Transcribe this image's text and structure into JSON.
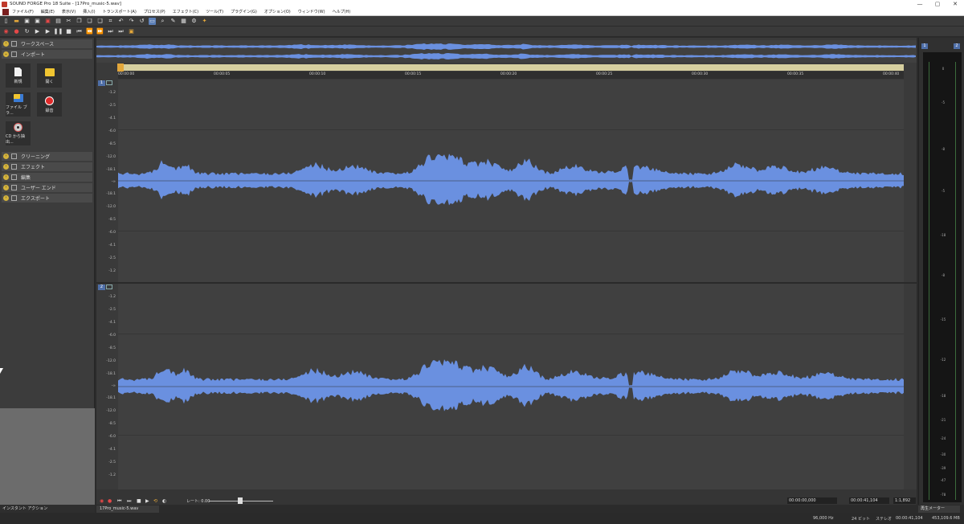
{
  "window": {
    "title": "SOUND FORGE Pro 18 Suite - [17Pro_music-5.wav]",
    "controls": [
      "—",
      "▢",
      "✕"
    ]
  },
  "menu": [
    "ファイル(F)",
    "編集(E)",
    "表示(V)",
    "挿入(I)",
    "トランスポート(A)",
    "プロセス(P)",
    "エフェクト(C)",
    "ツール(T)",
    "プラグイン(G)",
    "オプション(O)",
    "ウィンドウ(W)",
    "ヘルプ(H)"
  ],
  "left_panel": {
    "workspace": "ワークスペース",
    "import": "インポート",
    "tiles": [
      {
        "label": "新規",
        "icon": "new-file-icon"
      },
      {
        "label": "開く",
        "icon": "open-folder-icon"
      },
      {
        "label": "ファイル ブラ...",
        "icon": "file-browser-icon"
      },
      {
        "label": "録音",
        "icon": "record-icon"
      },
      {
        "label": "CD から抽出...",
        "icon": "cd-extract-icon"
      }
    ],
    "sections": [
      "クリーニング",
      "エフェクト",
      "編集",
      "ユーザー エンド",
      "エクスポート"
    ],
    "bottom_tab": "インスタント アクション"
  },
  "ruler": {
    "timecodes": [
      "00:00:00",
      "00:00:05",
      "00:00:10",
      "00:00:15",
      "00:00:20",
      "00:00:25",
      "00:00:30",
      "00:00:35",
      "00:00:40"
    ]
  },
  "tracks": {
    "channels": [
      "1",
      "2"
    ],
    "db_labels": [
      "-1.2",
      "-2.5",
      "-4.1",
      "-6.0",
      "-8.5",
      "-12.0",
      "-18.1",
      "-∞",
      "-18.1",
      "-12.0",
      "-8.5",
      "-6.0",
      "-4.1",
      "-2.5",
      "-1.2"
    ],
    "wave_color": "#6a90e0"
  },
  "transport": {
    "rate_label": "レート: 0.00",
    "start_time": "00:00:00,000",
    "end_time": "00:00:41,104",
    "zoom": "1:1,892"
  },
  "doc_tab": "17Pro_music-5.wav",
  "meter": {
    "channels": [
      "1",
      "2"
    ],
    "scale": [
      "0",
      "-5",
      "-8",
      "-5",
      "-18",
      "-8",
      "-15",
      "-12",
      "-18",
      "-21",
      "-24",
      "-30",
      "-39",
      "-47",
      "-78"
    ],
    "lr": [
      "L",
      "R"
    ],
    "tab": "再生メーター"
  },
  "status": {
    "sample_rate": "96,000 Hz",
    "bit_depth": "24 ビット",
    "channels": "ステレオ",
    "length": "00:00:41,104",
    "size": "453,109.6 MB"
  }
}
